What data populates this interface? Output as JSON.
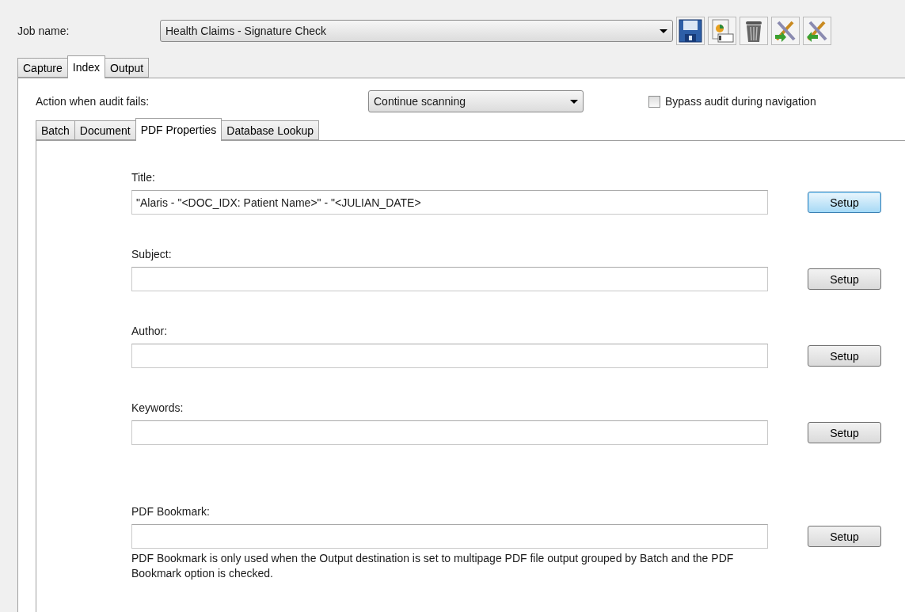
{
  "job": {
    "label": "Job name:",
    "value": "Health Claims - Signature Check"
  },
  "toolbar": [
    {
      "kind": "save"
    },
    {
      "kind": "properties"
    },
    {
      "kind": "delete"
    },
    {
      "kind": "import"
    },
    {
      "kind": "export"
    }
  ],
  "tabs": [
    {
      "label": "Capture",
      "selected": false
    },
    {
      "label": "Index",
      "selected": true
    },
    {
      "label": "Output",
      "selected": false
    }
  ],
  "audit": {
    "label": "Action when audit fails:",
    "value": "Continue scanning",
    "bypass": {
      "label": "Bypass audit during navigation",
      "checked": false
    }
  },
  "subtabs": [
    {
      "label": "Batch",
      "selected": false
    },
    {
      "label": "Document",
      "selected": false
    },
    {
      "label": "PDF Properties",
      "selected": true
    },
    {
      "label": "Database Lookup",
      "selected": false
    }
  ],
  "fields": [
    {
      "label": "Title:",
      "value": "\"Alaris - \"<DOC_IDX: Patient Name>\" - \"<JULIAN_DATE>",
      "button": "Setup",
      "focused": true
    },
    {
      "label": "Subject:",
      "button": "Setup",
      "focused": false
    },
    {
      "label": "Author:",
      "button": "Setup",
      "focused": false
    },
    {
      "label": "Keywords:",
      "button": "Setup",
      "focused": false
    },
    {
      "label": "PDF Bookmark:",
      "button": "Setup",
      "focused": false,
      "note": "PDF Bookmark is only used when the Output destination is set to multipage PDF file output grouped by Batch and the PDF Bookmark option is checked."
    }
  ]
}
